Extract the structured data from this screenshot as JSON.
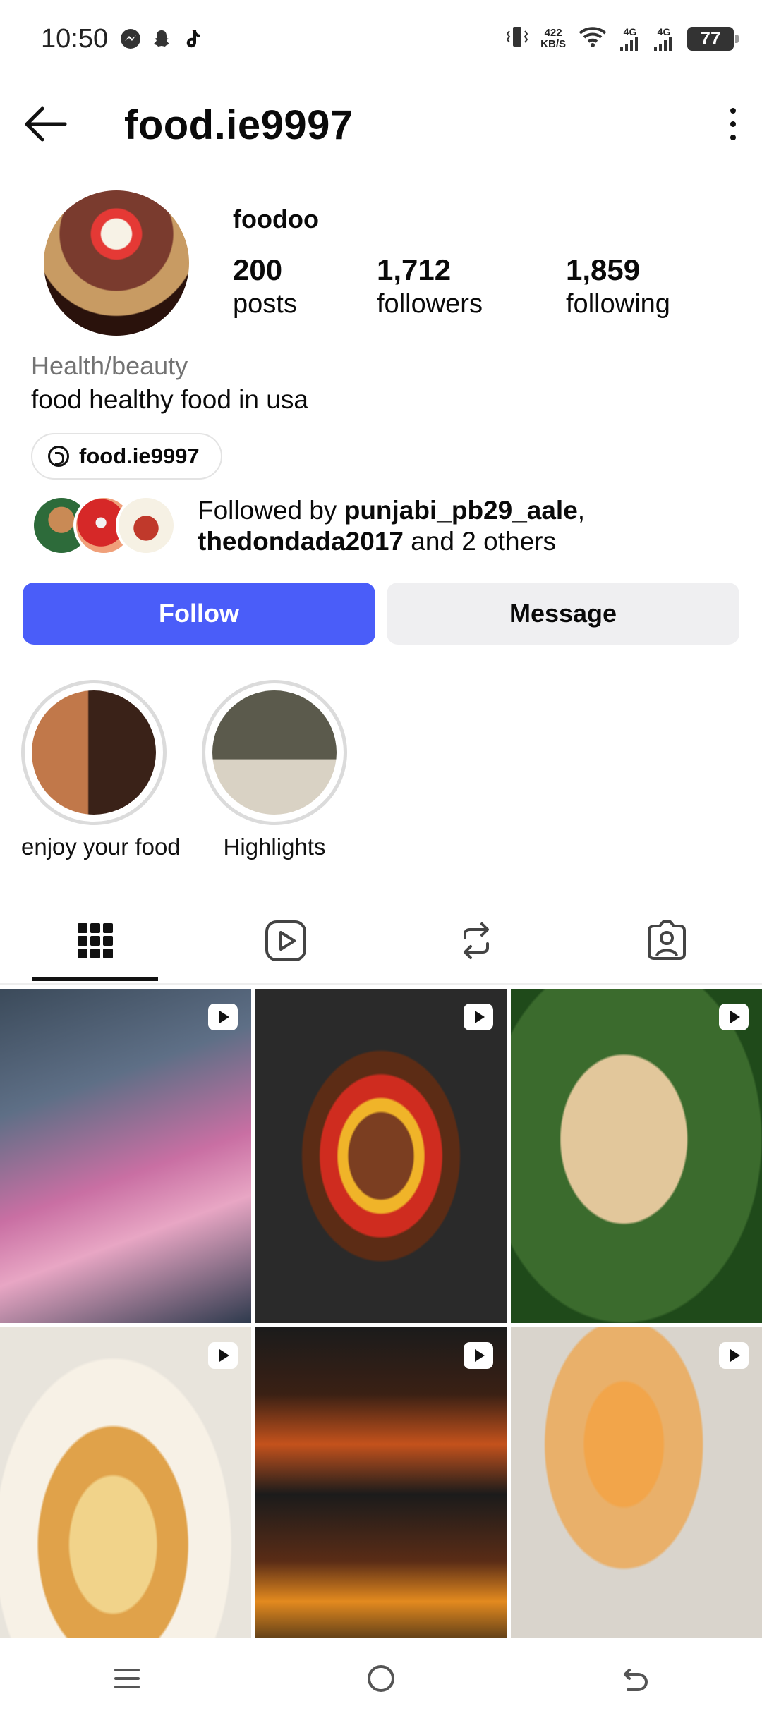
{
  "status_bar": {
    "time": "10:50",
    "net_speed_value": "422",
    "net_speed_unit": "KB/S",
    "sim1_label": "4G",
    "sim2_label": "4G",
    "battery": "77"
  },
  "header": {
    "username": "food.ie9997"
  },
  "profile": {
    "display_name": "foodoo",
    "stats": [
      {
        "value": "200",
        "label": "posts"
      },
      {
        "value": "1,712",
        "label": "followers"
      },
      {
        "value": "1,859",
        "label": "following"
      }
    ],
    "category": "Health/beauty",
    "bio": "food healthy food in usa",
    "threads_handle": "food.ie9997",
    "followed_by_prefix": "Followed by ",
    "followed_by_user1": "punjabi_pb29_aale",
    "followed_by_sep": ",",
    "followed_by_user2": "thedondada2017",
    "followed_by_suffix": " and 2 others"
  },
  "actions": {
    "follow": "Follow",
    "message": "Message"
  },
  "highlights": [
    {
      "label": "enjoy your food"
    },
    {
      "label": "Highlights"
    }
  ],
  "colors": {
    "follow_blue": "#4a5df9",
    "message_gray": "#efeff1",
    "category_gray": "#737373"
  },
  "icons": {
    "back": "arrow-left-icon",
    "more": "more-vertical-icon",
    "grid_tab": "grid-icon",
    "reels_tab": "reels-icon",
    "reposts_tab": "repost-icon",
    "tagged_tab": "tagged-icon",
    "reel_badge": "reel-badge-icon"
  }
}
